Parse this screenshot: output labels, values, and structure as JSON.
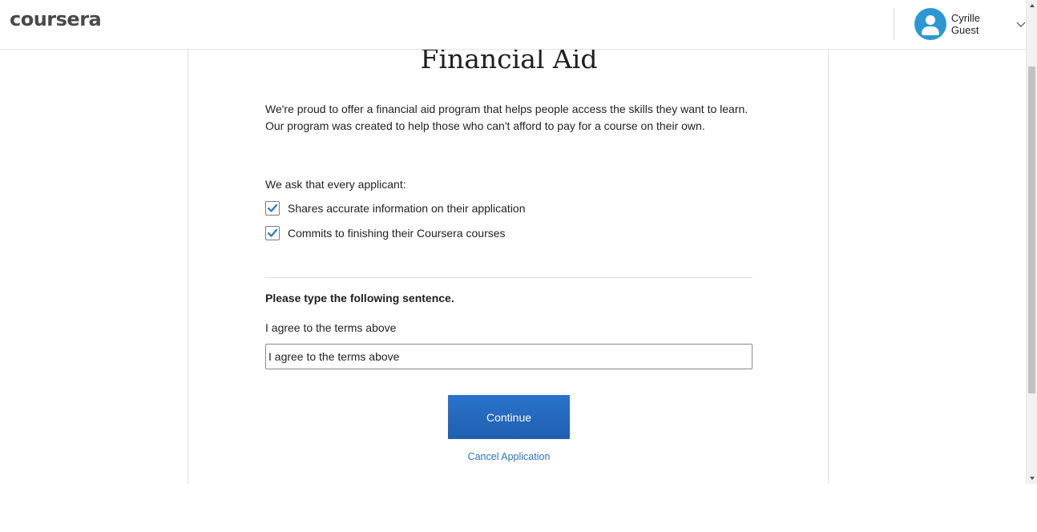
{
  "header": {
    "logo_text": "coursera",
    "user_name": "Cyrille Guest"
  },
  "main": {
    "title": "Financial Aid",
    "intro": "We're proud to offer a financial aid program that helps people access the skills they want to learn. Our program was created to help those who can't afford to pay for a course on their own.",
    "ask_label": "We ask that every applicant:",
    "checkboxes": [
      {
        "label": "Shares accurate information on their application",
        "checked": true
      },
      {
        "label": "Commits to finishing their Coursera courses",
        "checked": true
      }
    ],
    "prompt": "Please type the following sentence.",
    "sentence": "I agree to the terms above",
    "input_value": "I agree to the terms above",
    "continue_label": "Continue",
    "cancel_label": "Cancel Application"
  },
  "colors": {
    "accent": "#2a73cc",
    "avatar": "#2d97d3",
    "checkmark": "#2a73cc"
  },
  "icons": {
    "avatar": "user-avatar-icon",
    "chevron": "chevron-down-icon",
    "checkmark": "checkmark-icon"
  }
}
